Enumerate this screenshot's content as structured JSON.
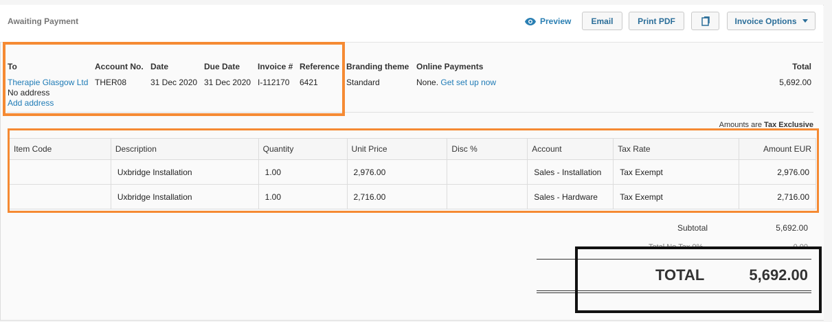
{
  "header": {
    "status": "Awaiting Payment",
    "preview_label": "Preview",
    "email_label": "Email",
    "print_label": "Print PDF",
    "options_label": "Invoice Options"
  },
  "details": {
    "to_label": "To",
    "to_name": "Therapie Glasgow Ltd",
    "to_address": "No address",
    "add_address": "Add address",
    "account_label": "Account No.",
    "account_value": "THER08",
    "date_label": "Date",
    "date_value": "31 Dec 2020",
    "due_label": "Due Date",
    "due_value": "31 Dec 2020",
    "invoice_label": "Invoice #",
    "invoice_value": "I-112170",
    "reference_label": "Reference",
    "reference_value": "6421",
    "branding_label": "Branding theme",
    "branding_value": "Standard",
    "online_label": "Online Payments",
    "online_value": "None.",
    "online_link": "Get set up now",
    "total_label": "Total",
    "total_value": "5,692.00"
  },
  "amounts_note": {
    "prefix": "Amounts are",
    "mode": "Tax Exclusive"
  },
  "table": {
    "headers": [
      "Item Code",
      "Description",
      "Quantity",
      "Unit Price",
      "Disc %",
      "Account",
      "Tax Rate",
      "Amount EUR"
    ],
    "rows": [
      [
        "",
        "Uxbridge Installation",
        "1.00",
        "2,976.00",
        "",
        "Sales - Installation",
        "Tax Exempt",
        "2,976.00"
      ],
      [
        "",
        "Uxbridge Installation",
        "1.00",
        "2,716.00",
        "",
        "Sales - Hardware",
        "Tax Exempt",
        "2,716.00"
      ]
    ]
  },
  "totals": {
    "subtotal_label": "Subtotal",
    "subtotal_value": "5,692.00",
    "tax_label": "Total No Tax 0%",
    "tax_value": "0.00",
    "total_label": "TOTAL",
    "total_value": "5,692.00"
  },
  "colors": {
    "highlight_orange": "#f58a33",
    "highlight_black": "#111111",
    "link_blue": "#1f7bb6"
  }
}
